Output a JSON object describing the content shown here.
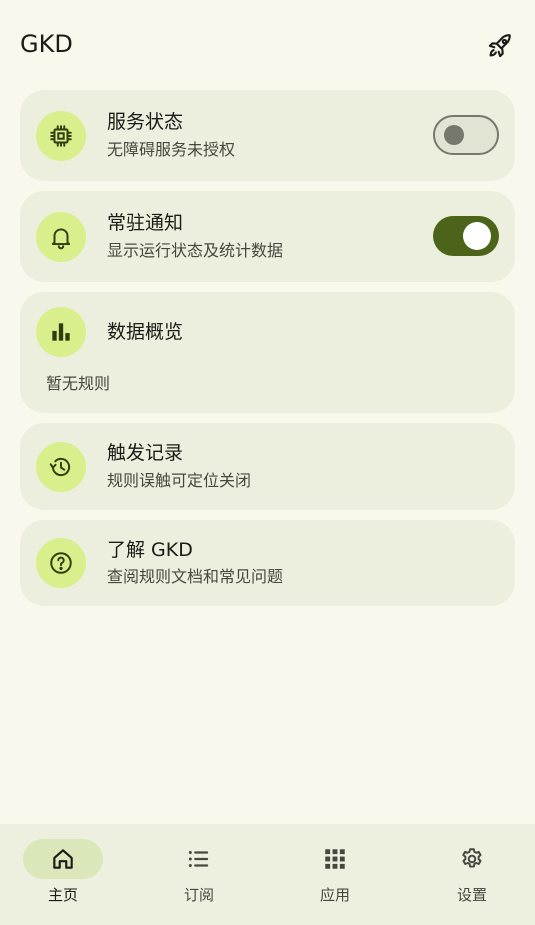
{
  "app": {
    "title": "GKD"
  },
  "cards": {
    "service": {
      "title": "服务状态",
      "subtitle": "无障碍服务未授权",
      "icon": "chip-icon",
      "switch_on": false
    },
    "notification": {
      "title": "常驻通知",
      "subtitle": "显示运行状态及统计数据",
      "icon": "bell-icon",
      "switch_on": true
    },
    "overview": {
      "title": "数据概览",
      "empty_text": "暂无规则",
      "icon": "bar-chart-icon"
    },
    "trigger_log": {
      "title": "触发记录",
      "subtitle": "规则误触可定位关闭",
      "icon": "history-icon"
    },
    "about": {
      "title": "了解 GKD",
      "subtitle": "查阅规则文档和常见问题",
      "icon": "help-icon"
    }
  },
  "bottom_nav": {
    "items": [
      {
        "label": "主页",
        "icon": "home-icon",
        "active": true
      },
      {
        "label": "订阅",
        "icon": "list-icon",
        "active": false
      },
      {
        "label": "应用",
        "icon": "apps-grid-icon",
        "active": false
      },
      {
        "label": "设置",
        "icon": "gear-icon",
        "active": false
      }
    ]
  },
  "colors": {
    "background": "#f8f9ec",
    "card": "#ecefdd",
    "icon_circle": "#d8ef8c",
    "switch_on": "#4c6419",
    "nav_active": "#d9e7ba"
  }
}
